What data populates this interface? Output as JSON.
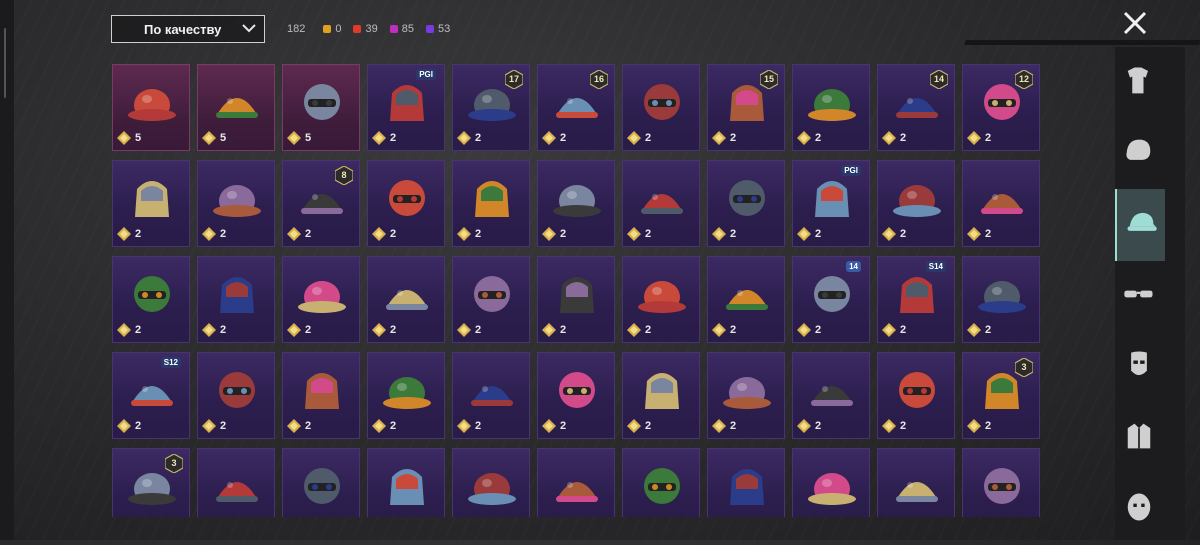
{
  "header": {
    "sort_label": "По качеству",
    "total_count": "182",
    "rarity_counts": [
      {
        "label": "0",
        "color": "#e0a020"
      },
      {
        "label": "39",
        "color": "#e03a2a"
      },
      {
        "label": "85",
        "color": "#c02ec0"
      },
      {
        "label": "53",
        "color": "#7a3ae0"
      }
    ]
  },
  "colors": {
    "gold_coin": "#d8b24a",
    "purple_tier": "#3c2a63",
    "pink_tier": "#5e2a4f",
    "active_tab": "#9fdcd6"
  },
  "items": [
    {
      "name": "gas-mask-helmet",
      "qty": "5",
      "tier": "pink"
    },
    {
      "name": "dinosaur-mask",
      "qty": "5",
      "tier": "pink"
    },
    {
      "name": "red-flower-hat",
      "qty": "5",
      "tier": "pink"
    },
    {
      "name": "heart-headband",
      "qty": "2",
      "tier": "purple",
      "badge": "PGI"
    },
    {
      "name": "gold-horned-mask",
      "qty": "2",
      "tier": "purple",
      "level": "17"
    },
    {
      "name": "camo-helmet",
      "qty": "2",
      "tier": "purple",
      "level": "16"
    },
    {
      "name": "blue-cap",
      "qty": "2",
      "tier": "purple"
    },
    {
      "name": "red-hair-hood",
      "qty": "2",
      "tier": "purple",
      "level": "15"
    },
    {
      "name": "goggles-hair",
      "qty": "2",
      "tier": "purple"
    },
    {
      "name": "blue-bird-hair",
      "qty": "2",
      "tier": "purple",
      "level": "14"
    },
    {
      "name": "bunny-ear-helmet",
      "qty": "2",
      "tier": "purple",
      "level": "12"
    },
    {
      "name": "pink-cat-beanie",
      "qty": "2",
      "tier": "purple"
    },
    {
      "name": "horn-headband",
      "qty": "2",
      "tier": "purple"
    },
    {
      "name": "green-skull-hood",
      "qty": "2",
      "tier": "purple",
      "level": "8"
    },
    {
      "name": "patterned-cap",
      "qty": "2",
      "tier": "purple"
    },
    {
      "name": "green-gasmask-helmet",
      "qty": "2",
      "tier": "purple"
    },
    {
      "name": "visor-helmet",
      "qty": "2",
      "tier": "purple"
    },
    {
      "name": "aviator-goggles-hair",
      "qty": "2",
      "tier": "purple"
    },
    {
      "name": "white-sun-hat",
      "qty": "2",
      "tier": "purple"
    },
    {
      "name": "green-hair",
      "qty": "2",
      "tier": "purple",
      "badge": "PGI"
    },
    {
      "name": "red-motorbike-helmet",
      "qty": "2",
      "tier": "purple"
    },
    {
      "name": "blue-cricket-helmet",
      "qty": "2",
      "tier": "purple"
    },
    {
      "name": "steampunk-hat",
      "qty": "2",
      "tier": "purple"
    },
    {
      "name": "braided-hair-mask",
      "qty": "2",
      "tier": "purple"
    },
    {
      "name": "purple-witch-hat",
      "qty": "2",
      "tier": "purple"
    },
    {
      "name": "black-respirator",
      "qty": "2",
      "tier": "purple"
    },
    {
      "name": "goggles-beanie",
      "qty": "2",
      "tier": "purple"
    },
    {
      "name": "yellow-beanie",
      "qty": "2",
      "tier": "purple"
    },
    {
      "name": "striped-scarf-hat",
      "qty": "2",
      "tier": "purple"
    },
    {
      "name": "red-bandana-mask",
      "qty": "2",
      "tier": "purple"
    },
    {
      "name": "police-cap",
      "qty": "2",
      "tier": "purple",
      "badge": "14"
    },
    {
      "name": "spartan-helmet",
      "qty": "2",
      "tier": "purple",
      "badge": "S14"
    },
    {
      "name": "pink-cap",
      "qty": "2",
      "tier": "purple"
    },
    {
      "name": "astronaut-helmet",
      "qty": "2",
      "tier": "purple",
      "badge": "S12"
    },
    {
      "name": "scarecrow-hat",
      "qty": "2",
      "tier": "purple"
    },
    {
      "name": "cowboy-hat",
      "qty": "2",
      "tier": "purple"
    },
    {
      "name": "ninja-helmet",
      "qty": "2",
      "tier": "purple"
    },
    {
      "name": "shark-hood",
      "qty": "2",
      "tier": "purple"
    },
    {
      "name": "red-beret",
      "qty": "2",
      "tier": "purple"
    },
    {
      "name": "black-fedora",
      "qty": "2",
      "tier": "purple"
    },
    {
      "name": "red-fedora",
      "qty": "2",
      "tier": "purple"
    },
    {
      "name": "white-shark-hood",
      "qty": "2",
      "tier": "purple"
    },
    {
      "name": "red-bucket-hat",
      "qty": "2",
      "tier": "purple"
    },
    {
      "name": "dark-fedora",
      "qty": "2",
      "tier": "purple",
      "level": "3"
    },
    {
      "name": "flower-crown",
      "qty": "",
      "tier": "purple",
      "level": "3"
    },
    {
      "name": "cake-hat",
      "qty": "",
      "tier": "purple"
    },
    {
      "name": "burger-hat",
      "qty": "",
      "tier": "purple"
    },
    {
      "name": "headlamp",
      "qty": "",
      "tier": "purple"
    },
    {
      "name": "headband",
      "qty": "",
      "tier": "purple"
    },
    {
      "name": "blue-sailor-cap",
      "qty": "",
      "tier": "purple"
    },
    {
      "name": "black-baseball-cap",
      "qty": "",
      "tier": "purple"
    },
    {
      "name": "blue-trucker-cap",
      "qty": "",
      "tier": "purple"
    },
    {
      "name": "maroon-fedora",
      "qty": "",
      "tier": "purple"
    },
    {
      "name": "camo-helmet-2",
      "qty": "",
      "tier": "purple"
    },
    {
      "name": "black-bucket-hat",
      "qty": "",
      "tier": "purple"
    }
  ],
  "side_tabs": [
    {
      "name": "outfit-icon",
      "active": false
    },
    {
      "name": "hair-icon",
      "active": false
    },
    {
      "name": "hat-icon",
      "active": true
    },
    {
      "name": "glasses-icon",
      "active": false
    },
    {
      "name": "mask-icon",
      "active": false
    },
    {
      "name": "jacket-icon",
      "active": false
    },
    {
      "name": "face-icon",
      "active": false
    }
  ]
}
